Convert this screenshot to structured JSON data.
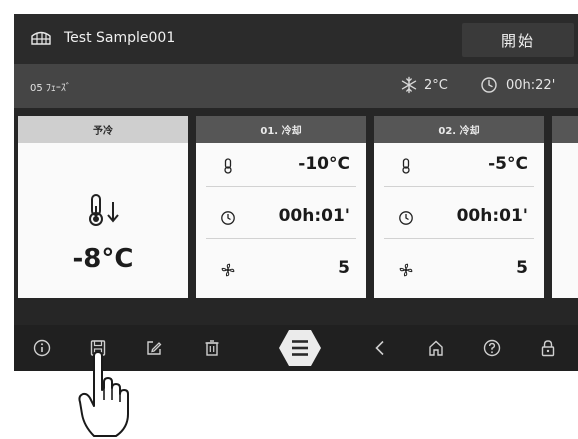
{
  "header": {
    "sample_name": "Test Sample001",
    "start_label": "開始"
  },
  "status": {
    "phase_count": "05 ﾌｪｰｽﾞ",
    "temperature": "2°C",
    "time": "00h:22'"
  },
  "precool": {
    "title": "予冷",
    "temperature": "-8°C"
  },
  "steps": [
    {
      "title": "01. 冷却",
      "temperature": "-10°C",
      "time": "00h:01'",
      "fan": "5"
    },
    {
      "title": "02. 冷却",
      "temperature": "-5°C",
      "time": "00h:01'",
      "fan": "5"
    }
  ],
  "icons": {
    "app": "trays-icon",
    "snow": "snowflake-icon",
    "clock": "clock-icon",
    "thermometer": "thermometer-icon",
    "fan": "fan-icon",
    "bottom_nav": [
      "info-icon",
      "save-icon",
      "edit-icon",
      "delete-icon",
      "menu-icon",
      "back-icon",
      "home-icon",
      "help-icon",
      "lock-icon"
    ]
  },
  "colors": {
    "screen_bg": "#262626",
    "card_bg": "#fafafa",
    "step_header": "#565656",
    "menu_button": "#ebebeb"
  }
}
